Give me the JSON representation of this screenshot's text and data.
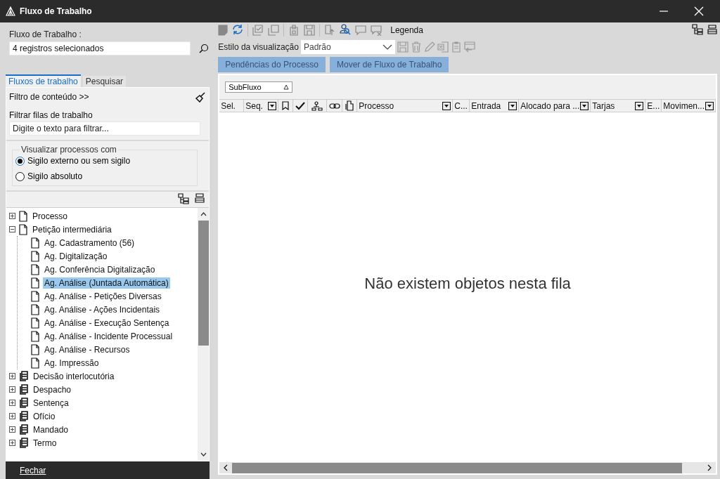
{
  "window": {
    "title": "Fluxo de Trabalho"
  },
  "workflow_field": {
    "label": "Fluxo de Trabalho :",
    "value": "4 registros selecionados"
  },
  "tabs": [
    {
      "label": "Fluxos de trabalho",
      "selected": true
    },
    {
      "label": "Pesquisar",
      "selected": false
    }
  ],
  "content_filter": {
    "toggle": "Filtro de conteúdo >>",
    "label": "Filtrar filas de trabalho",
    "value": "Digite o texto para filtrar..."
  },
  "visibility": {
    "legend": "Visualizar processos com",
    "options": [
      {
        "label": "Sigilo externo ou sem sigilo",
        "selected": true
      },
      {
        "label": "Sigilo absoluto",
        "selected": false
      }
    ]
  },
  "tree": [
    {
      "label": "Processo",
      "kind": "queue",
      "expanded": false,
      "selected": false
    },
    {
      "label": "Petição intermediária",
      "kind": "queue",
      "expanded": true,
      "selected": false,
      "children": [
        {
          "label": "Ag. Cadastramento (56)",
          "kind": "queue",
          "selected": false
        },
        {
          "label": "Ag. Digitalização",
          "kind": "queue",
          "selected": false
        },
        {
          "label": "Ag. Conferência Digitalização",
          "kind": "queue",
          "selected": false
        },
        {
          "label": "Ag. Análise (Juntada Automática)",
          "kind": "queue",
          "selected": true
        },
        {
          "label": "Ag. Análise - Petições Diversas",
          "kind": "queue",
          "selected": false
        },
        {
          "label": "Ag. Análise - Ações Incidentais",
          "kind": "queue",
          "selected": false
        },
        {
          "label": "Ag. Análise - Execução Sentença",
          "kind": "queue",
          "selected": false
        },
        {
          "label": "Ag. Análise - Incidente Processual",
          "kind": "queue",
          "selected": false
        },
        {
          "label": "Ag. Análise - Recursos",
          "kind": "queue",
          "selected": false
        },
        {
          "label": "Ag. Impressão",
          "kind": "queue",
          "selected": false
        }
      ]
    },
    {
      "label": "Decisão interlocutória",
      "kind": "group",
      "expanded": false,
      "selected": false
    },
    {
      "label": "Despacho",
      "kind": "group",
      "expanded": false,
      "selected": false
    },
    {
      "label": "Sentença",
      "kind": "group",
      "expanded": false,
      "selected": false
    },
    {
      "label": "Ofício",
      "kind": "group",
      "expanded": false,
      "selected": false
    },
    {
      "label": "Mandado",
      "kind": "group",
      "expanded": false,
      "selected": false
    },
    {
      "label": "Termo",
      "kind": "group",
      "expanded": false,
      "selected": false
    }
  ],
  "footer": {
    "close": "Fechar"
  },
  "toolbar": {
    "legend": "Legenda"
  },
  "view_style": {
    "label": "Estilo da visualização",
    "value": "Padrão"
  },
  "actions": [
    {
      "label": "Pendências do Processo",
      "disabled": true
    },
    {
      "label": "Mover de Fluxo de Trabalho",
      "disabled": true
    }
  ],
  "grouping": {
    "chip": "SubFluxo"
  },
  "columns": [
    {
      "kind": "text",
      "label": "Sel.",
      "dropdown": false
    },
    {
      "kind": "text",
      "label": "Seq.",
      "dropdown": true
    },
    {
      "kind": "icon"
    },
    {
      "kind": "icon"
    },
    {
      "kind": "icon"
    },
    {
      "kind": "icon"
    },
    {
      "kind": "icon"
    },
    {
      "kind": "text",
      "label": "Processo",
      "dropdown": true
    },
    {
      "kind": "text",
      "label": "C...",
      "dropdown": false
    },
    {
      "kind": "text",
      "label": "Entrada",
      "dropdown": true
    },
    {
      "kind": "text",
      "label": "Alocado para ...",
      "dropdown": true
    },
    {
      "kind": "text",
      "label": "Tarjas",
      "dropdown": true
    },
    {
      "kind": "text",
      "label": "E...",
      "dropdown": false
    },
    {
      "kind": "text",
      "label": "Movimen...",
      "dropdown": true
    }
  ],
  "empty_message": "Não existem objetos nesta fila"
}
